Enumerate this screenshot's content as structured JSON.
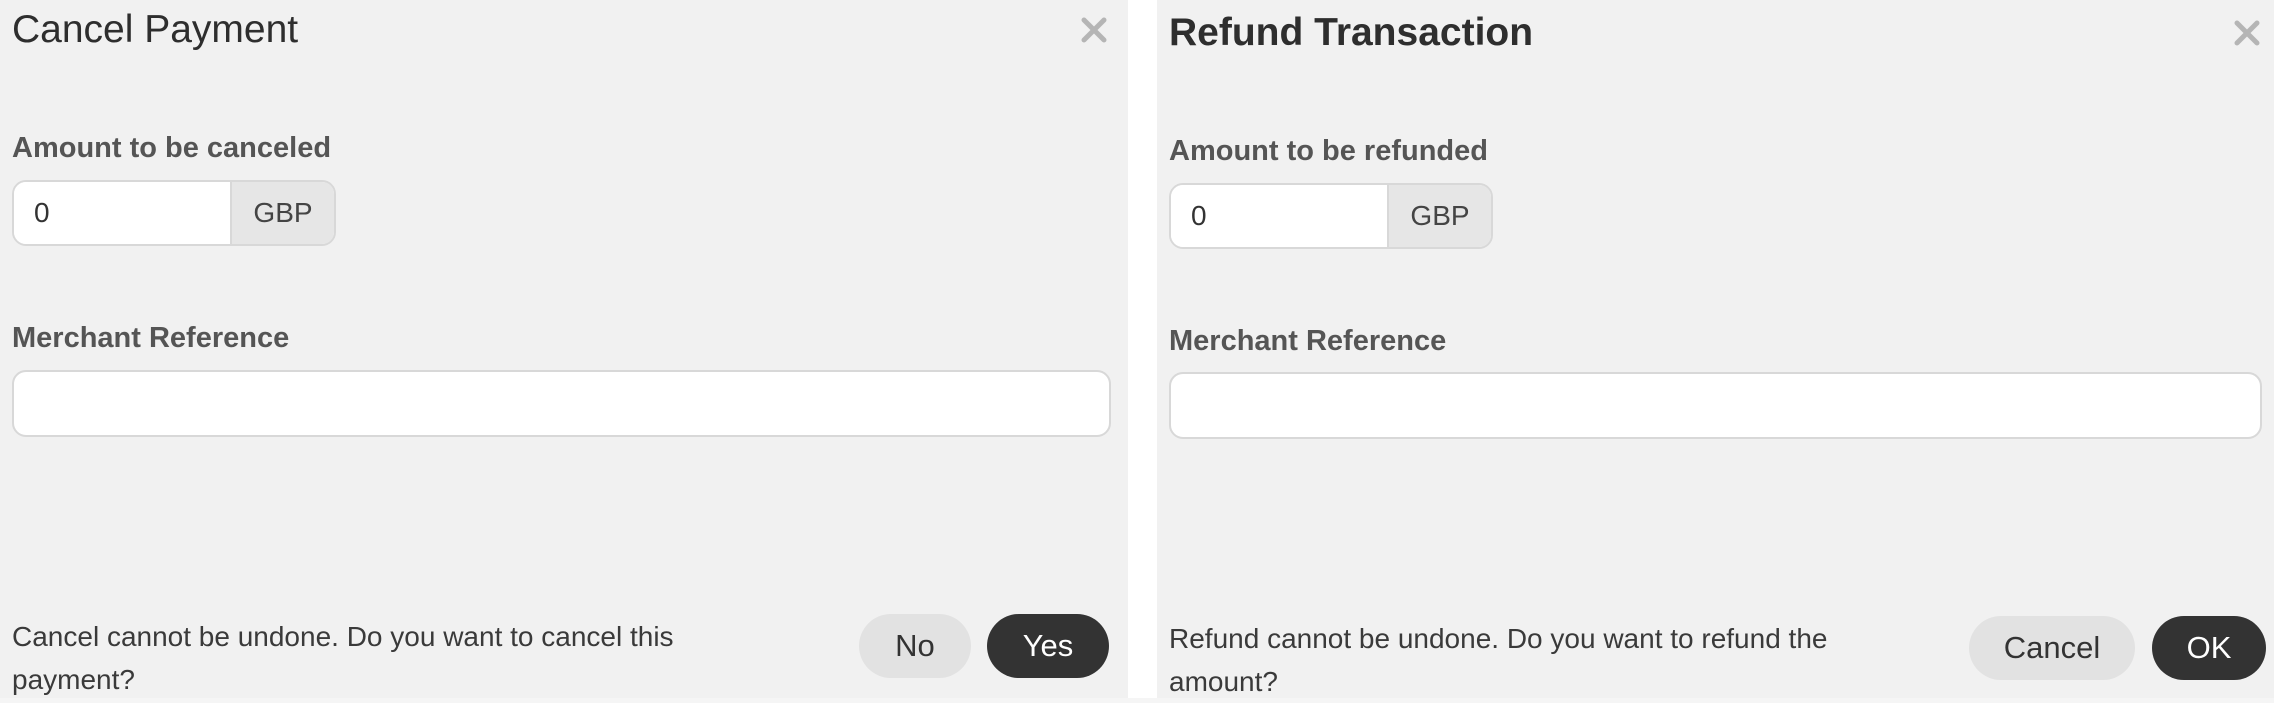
{
  "cancel_dialog": {
    "title": "Cancel Payment",
    "close_icon": "close-icon",
    "amount_label": "Amount to be canceled",
    "amount_value": "0",
    "currency": "GBP",
    "reference_label": "Merchant Reference",
    "reference_value": "",
    "confirm_text": "Cancel cannot be undone. Do you want to cancel this payment?",
    "no_label": "No",
    "yes_label": "Yes"
  },
  "refund_dialog": {
    "title": "Refund Transaction",
    "close_icon": "close-icon",
    "amount_label": "Amount to be refunded",
    "amount_value": "0",
    "currency": "GBP",
    "reference_label": "Merchant Reference",
    "reference_value": "",
    "confirm_text": "Refund cannot be undone. Do you want to refund the amount?",
    "cancel_label": "Cancel",
    "ok_label": "OK"
  },
  "colors": {
    "dialog_background": "#f1f1f1",
    "primary_button": "#333333",
    "secondary_button": "#e2e2e2",
    "currency_addon": "#e6e6e6"
  }
}
